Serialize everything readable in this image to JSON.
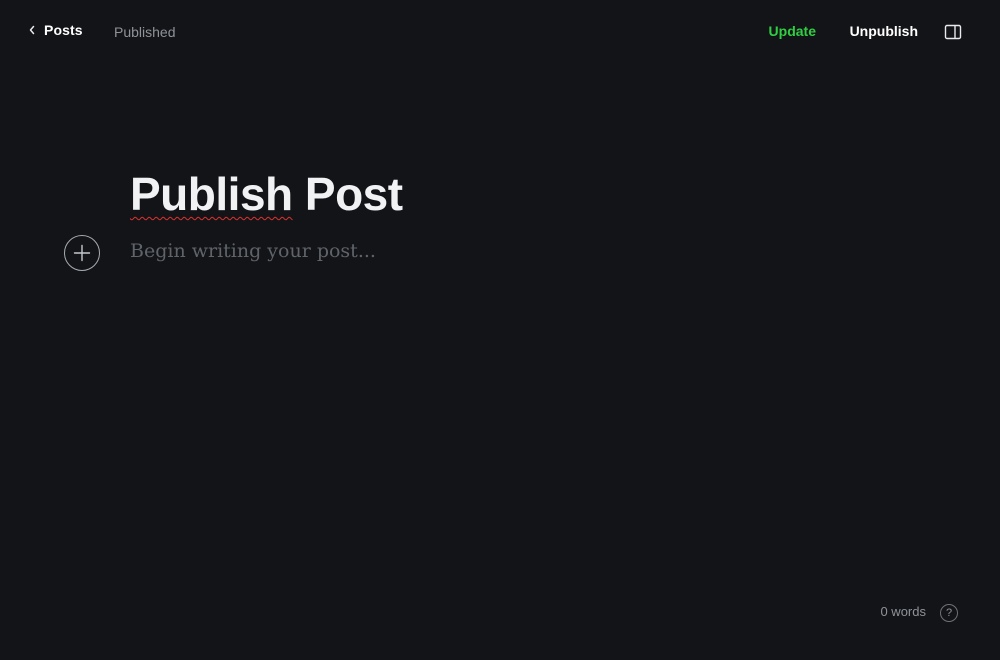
{
  "header": {
    "back_label": "Posts",
    "status": "Published",
    "update_label": "Update",
    "unpublish_label": "Unpublish"
  },
  "editor": {
    "title_word_1": "Publish",
    "title_word_2": " Post",
    "body_placeholder": "Begin writing your post..."
  },
  "footer": {
    "word_count": "0 words",
    "help_symbol": "?"
  },
  "icons": {
    "back": "chevron-left-icon",
    "sidebar_toggle": "sidebar-panel-icon",
    "add_card": "plus-icon",
    "help": "question-mark-icon"
  },
  "colors": {
    "background": "#131417",
    "accent_green": "#30cf43",
    "spellcheck_red": "#e0312f"
  }
}
